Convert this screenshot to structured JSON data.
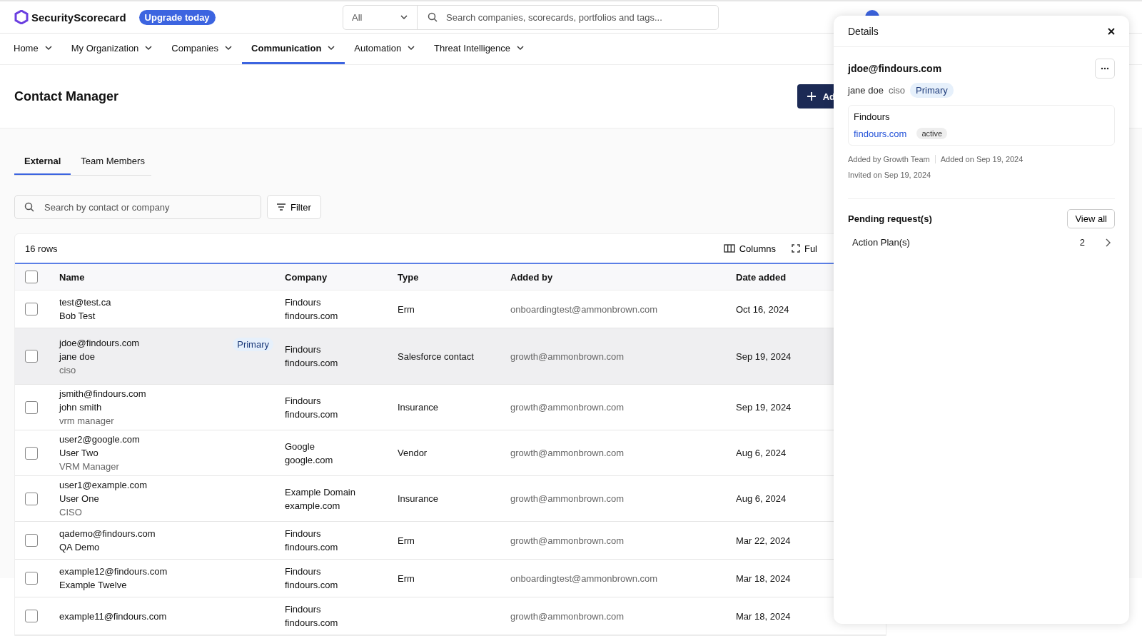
{
  "brand": {
    "name": "SecurityScorecard",
    "upgrade": "Upgrade today"
  },
  "search": {
    "scope": "All",
    "placeholder": "Search companies, scorecards, portfolios and tags..."
  },
  "nav": [
    {
      "label": "Home",
      "selected": false
    },
    {
      "label": "My Organization",
      "selected": false
    },
    {
      "label": "Companies",
      "selected": false
    },
    {
      "label": "Communication",
      "selected": true
    },
    {
      "label": "Automation",
      "selected": false
    },
    {
      "label": "Threat Intelligence",
      "selected": false
    }
  ],
  "page": {
    "title": "Contact Manager",
    "add_button": "Ad"
  },
  "tabs": [
    {
      "label": "External",
      "selected": true
    },
    {
      "label": "Team Members",
      "selected": false
    }
  ],
  "contact_search": {
    "placeholder": "Search by contact or company"
  },
  "filter_button": "Filter",
  "table": {
    "row_count": "16 rows",
    "columns_button": "Columns",
    "fullscreen_button": "Ful",
    "select_all_checked": false,
    "columns": [
      "Name",
      "Company",
      "Type",
      "Added by",
      "Date added"
    ],
    "rows": [
      {
        "checked": false,
        "selected": false,
        "email": "test@test.ca",
        "name": "Bob Test",
        "role": "",
        "badge": "",
        "company": "Findours",
        "domain": "findours.com",
        "type": "Erm",
        "added_by": "onboardingtest@ammonbrown.com",
        "date": "Oct 16, 2024"
      },
      {
        "checked": false,
        "selected": true,
        "email": "jdoe@findours.com",
        "name": "jane doe",
        "role": "ciso",
        "badge": "Primary",
        "company": "Findours",
        "domain": "findours.com",
        "type": "Salesforce contact",
        "added_by": "growth@ammonbrown.com",
        "date": "Sep 19, 2024"
      },
      {
        "checked": false,
        "selected": false,
        "email": "jsmith@findours.com",
        "name": "john smith",
        "role": "vrm manager",
        "badge": "",
        "company": "Findours",
        "domain": "findours.com",
        "type": "Insurance",
        "added_by": "growth@ammonbrown.com",
        "date": "Sep 19, 2024"
      },
      {
        "checked": false,
        "selected": false,
        "email": "user2@google.com",
        "name": "User Two",
        "role": "VRM Manager",
        "badge": "",
        "company": "Google",
        "domain": "google.com",
        "type": "Vendor",
        "added_by": "growth@ammonbrown.com",
        "date": "Aug 6, 2024"
      },
      {
        "checked": false,
        "selected": false,
        "email": "user1@example.com",
        "name": "User One",
        "role": "CISO",
        "badge": "",
        "company": "Example Domain",
        "domain": "example.com",
        "type": "Insurance",
        "added_by": "growth@ammonbrown.com",
        "date": "Aug 6, 2024"
      },
      {
        "checked": false,
        "selected": false,
        "email": "qademo@findours.com",
        "name": "QA Demo",
        "role": "",
        "badge": "",
        "company": "Findours",
        "domain": "findours.com",
        "type": "Erm",
        "added_by": "growth@ammonbrown.com",
        "date": "Mar 22, 2024"
      },
      {
        "checked": false,
        "selected": false,
        "email": "example12@findours.com",
        "name": "Example Twelve",
        "role": "",
        "badge": "",
        "company": "Findours",
        "domain": "findours.com",
        "type": "Erm",
        "added_by": "onboardingtest@ammonbrown.com",
        "date": "Mar 18, 2024"
      },
      {
        "checked": false,
        "selected": false,
        "email": "example11@findours.com",
        "name": "",
        "role": "",
        "badge": "",
        "company": "Findours",
        "domain": "findours.com",
        "type": "",
        "added_by": "growth@ammonbrown.com",
        "date": "Mar 18, 2024"
      }
    ]
  },
  "details": {
    "title": "Details",
    "email": "jdoe@findours.com",
    "name": "jane doe",
    "role": "ciso",
    "badge": "Primary",
    "company": "Findours",
    "domain": "findours.com",
    "status": "active",
    "added_by": "Added by Growth Team",
    "added_on": "Added on Sep 19, 2024",
    "invited_on": "Invited on Sep 19, 2024",
    "pending_title": "Pending request(s)",
    "view_all": "View all",
    "requests": [
      {
        "label": "Action Plan(s)",
        "count": "2"
      }
    ]
  }
}
